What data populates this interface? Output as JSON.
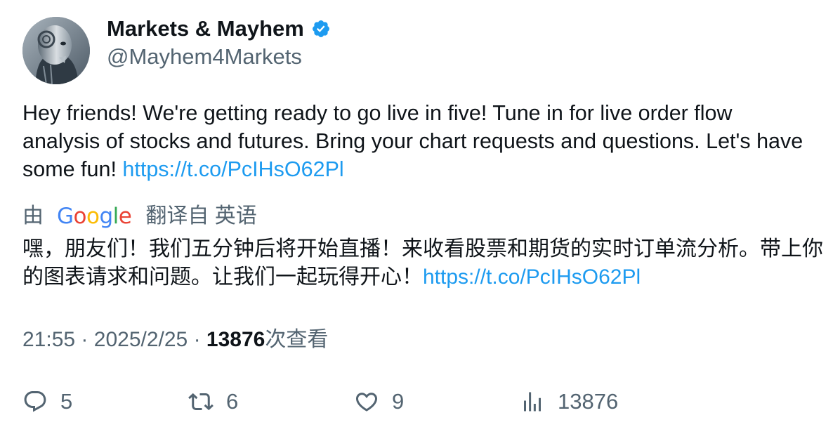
{
  "author": {
    "name": "Markets & Mayhem",
    "handle": "@Mayhem4Markets",
    "verified": true,
    "accent_color": "#1d9bf0"
  },
  "tweet": {
    "text": "Hey friends! We're getting ready to go live in five! Tune in for live order flow analysis of stocks and futures. Bring your chart requests and questions. Let's have some fun! ",
    "link": "https://t.co/PcIHsO62Pl"
  },
  "translation": {
    "by_label": "由",
    "provider": "Google",
    "from_label": "翻译自 英语",
    "text": "嘿，朋友们！我们五分钟后将开始直播！来收看股票和期货的实时订单流分析。带上你的图表请求和问题。让我们一起玩得开心！",
    "link": "https://t.co/PcIHsO62Pl"
  },
  "meta": {
    "time": "21:55",
    "date": "2025/2/25",
    "separator": "·",
    "views": "13876",
    "views_label": "次查看"
  },
  "actions": {
    "replies": "5",
    "retweets": "6",
    "likes": "9",
    "views": "13876"
  },
  "icons": {
    "reply": "reply-icon",
    "retweet": "retweet-icon",
    "like": "heart-icon",
    "views": "analytics-icon",
    "verified": "verified-badge-icon"
  }
}
